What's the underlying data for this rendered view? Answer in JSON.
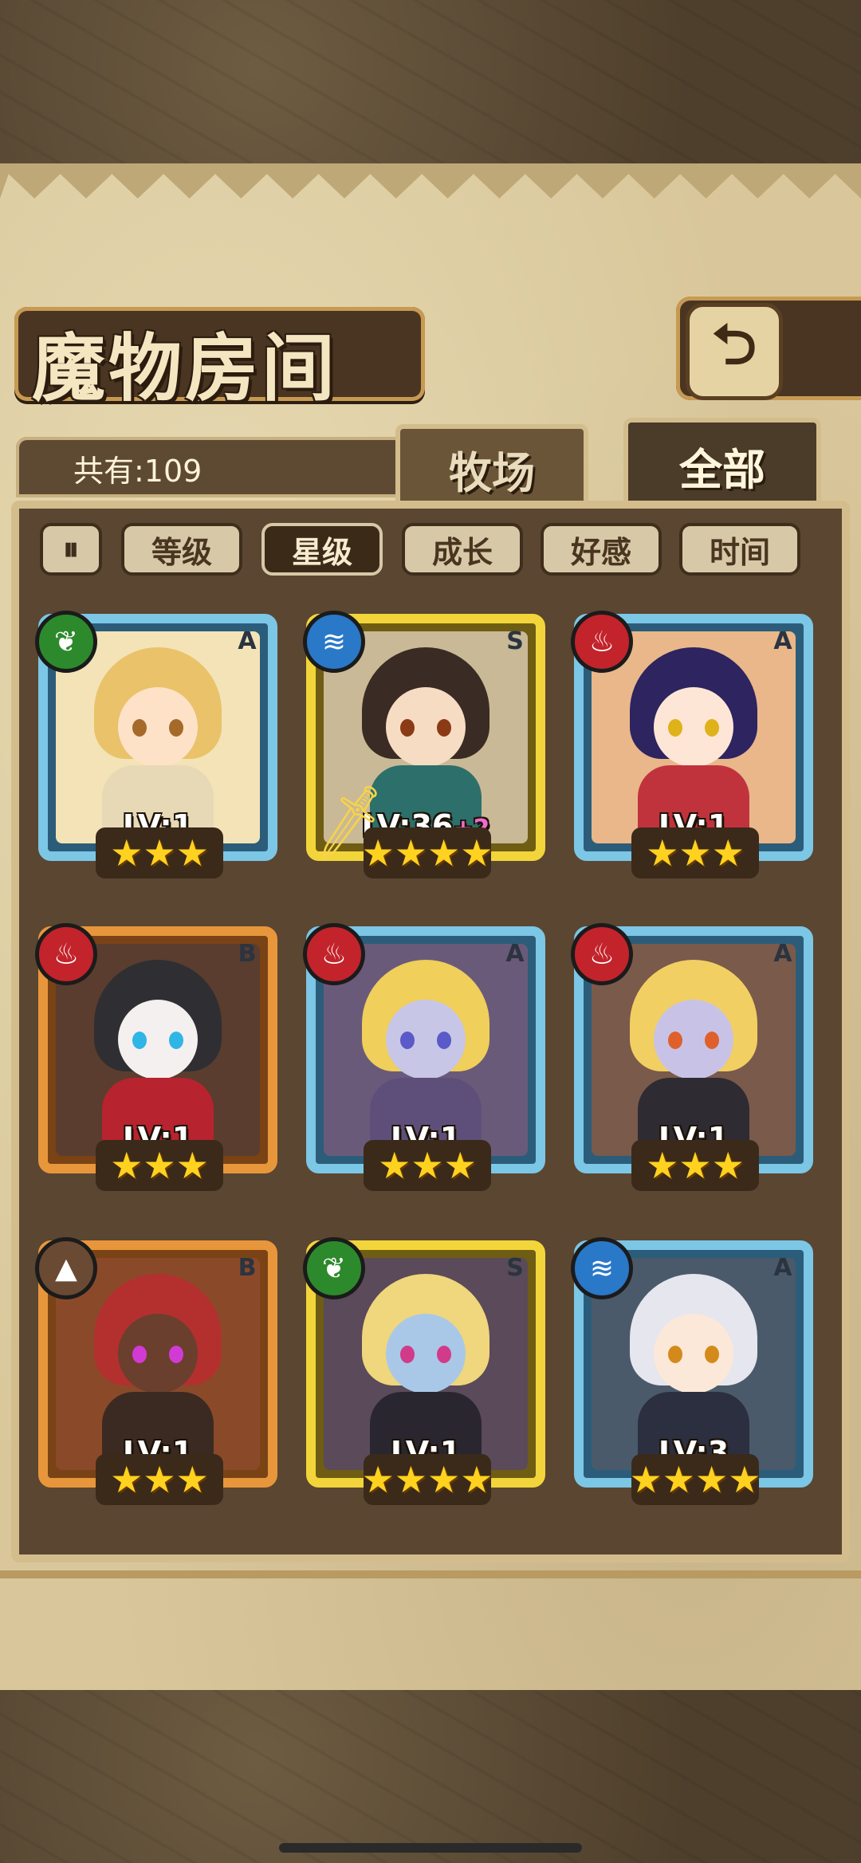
{
  "header": {
    "title": "魔物房间",
    "back_icon": "return-arrow-icon"
  },
  "summary": {
    "count_label": "共有:109"
  },
  "tabs": [
    {
      "label": "牧场",
      "active": false
    },
    {
      "label": "全部",
      "active": true
    }
  ],
  "sort_toggle": {
    "label": "⏸",
    "icon": "sort-order-icon"
  },
  "filters": [
    {
      "label": "等级",
      "active": false
    },
    {
      "label": "星级",
      "active": true
    },
    {
      "label": "成长",
      "active": false
    },
    {
      "label": "好感",
      "active": false
    },
    {
      "label": "时间",
      "active": false
    }
  ],
  "monsters": [
    {
      "rank": "A",
      "element": "wood",
      "element_icon": "leaf-icon",
      "level": "LV:1",
      "bonus": "",
      "stars": "★★★"
    },
    {
      "rank": "S",
      "element": "water",
      "element_icon": "water-wave-icon",
      "level": "LV:36",
      "bonus": "+2",
      "stars": "★★★★"
    },
    {
      "rank": "A",
      "element": "fire",
      "element_icon": "flame-icon",
      "level": "LV:1",
      "bonus": "",
      "stars": "★★★"
    },
    {
      "rank": "B",
      "element": "fire",
      "element_icon": "flame-icon",
      "level": "LV:1",
      "bonus": "",
      "stars": "★★★"
    },
    {
      "rank": "A",
      "element": "fire",
      "element_icon": "flame-icon",
      "level": "LV:1",
      "bonus": "",
      "stars": "★★★"
    },
    {
      "rank": "A",
      "element": "fire",
      "element_icon": "flame-icon",
      "level": "LV:1",
      "bonus": "",
      "stars": "★★★"
    },
    {
      "rank": "B",
      "element": "earth",
      "element_icon": "mountain-icon",
      "level": "LV:1",
      "bonus": "",
      "stars": "★★★"
    },
    {
      "rank": "S",
      "element": "wood",
      "element_icon": "leaf-icon",
      "level": "LV:1",
      "bonus": "",
      "stars": "★★★★"
    },
    {
      "rank": "A",
      "element": "water",
      "element_icon": "water-wave-icon",
      "level": "LV:3",
      "bonus": "",
      "stars": "★★★★"
    }
  ],
  "colors": {
    "rank_a": "#7cc6e6",
    "rank_s": "#f2d53a",
    "rank_b": "#e8963b",
    "star": "#ffd21f"
  }
}
